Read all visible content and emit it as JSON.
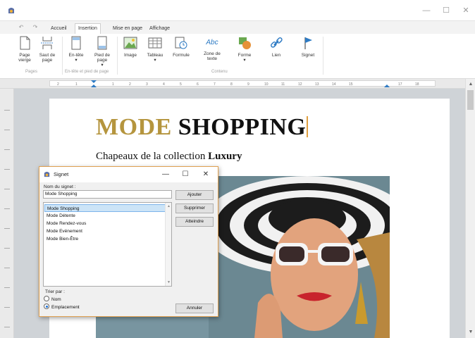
{
  "window": {
    "minimize_glyph": "—",
    "maximize_glyph": "☐",
    "close_glyph": "✕",
    "accent_color": "#1f6fd1"
  },
  "quick_access": {
    "undo_glyph": "↶",
    "redo_glyph": "↷"
  },
  "tabs": [
    {
      "label": "Accueil",
      "active": false
    },
    {
      "label": "Insertion",
      "active": true
    },
    {
      "label": "Mise en page",
      "active": false
    },
    {
      "label": "Affichage",
      "active": false
    }
  ],
  "ribbon": {
    "buttons": [
      {
        "label": "Page vierge",
        "icon": "blank-page-icon"
      },
      {
        "label": "Saut de page",
        "icon": "page-break-icon"
      },
      {
        "label": "En-tête",
        "sublabel": "▾",
        "icon": "header-icon"
      },
      {
        "label": "Pied de page",
        "sublabel": "▾",
        "icon": "footer-icon"
      },
      {
        "label": "Image",
        "icon": "image-icon"
      },
      {
        "label": "Tableau",
        "sublabel": "▾",
        "icon": "table-icon"
      },
      {
        "label": "Formule",
        "icon": "formula-icon"
      },
      {
        "label": "Zone de texte",
        "icon": "text-box-icon",
        "icon_text": "Abc"
      },
      {
        "label": "Forme",
        "sublabel": "▾",
        "icon": "shape-icon"
      },
      {
        "label": "Lien",
        "icon": "link-icon"
      },
      {
        "label": "Signet",
        "icon": "bookmark-icon"
      }
    ],
    "groups": [
      "Pages",
      "En-tête et pied de page",
      "Contenu"
    ]
  },
  "ruler": {
    "marks": [
      "2",
      "1",
      "1",
      "2",
      "3",
      "4",
      "5",
      "6",
      "7",
      "8",
      "9",
      "10",
      "11",
      "12",
      "13",
      "14",
      "15",
      "17",
      "18"
    ]
  },
  "document": {
    "title_word1": "MODE",
    "title_word2": "SHOPPING",
    "subtitle_prefix": "Chapeaux de la collection ",
    "subtitle_bold": "Luxury",
    "title_accent_color": "#b5953e"
  },
  "dialog": {
    "title": "Signet",
    "field_label": "Nom du signet :",
    "name_value": "Mode Shopping",
    "buttons": {
      "add": "Ajouter",
      "delete": "Supprimer",
      "goto": "Atteindre",
      "cancel": "Annuler"
    },
    "list_items": [
      {
        "label": "Mode Shopping",
        "selected": true
      },
      {
        "label": "Mode Détente",
        "selected": false
      },
      {
        "label": "Mode Rendez-vous",
        "selected": false
      },
      {
        "label": "Mode Evénement",
        "selected": false
      },
      {
        "label": "Mode Bien-Être",
        "selected": false
      }
    ],
    "sort_label": "Trier par :",
    "sort_options": [
      {
        "label": "Nom",
        "checked": false
      },
      {
        "label": "Emplacement",
        "checked": true
      }
    ]
  }
}
